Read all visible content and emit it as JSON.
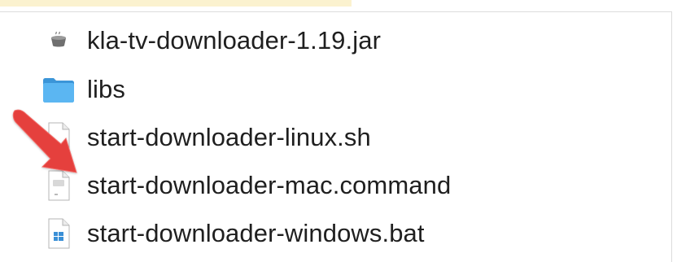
{
  "files": [
    {
      "name": "kla-tv-downloader-1.19.jar",
      "icon": "jar-icon",
      "type": "jar"
    },
    {
      "name": "libs",
      "icon": "folder-icon",
      "type": "folder"
    },
    {
      "name": "start-downloader-linux.sh",
      "icon": "document-icon",
      "type": "shell"
    },
    {
      "name": "start-downloader-mac.command",
      "icon": "terminal-document-icon",
      "type": "command"
    },
    {
      "name": "start-downloader-windows.bat",
      "icon": "windows-document-icon",
      "type": "bat"
    }
  ],
  "annotation": {
    "icon": "red-arrow-icon",
    "color": "#e5413d",
    "target": "start-downloader-mac.command"
  },
  "colors": {
    "highlight": "#fbf2cf",
    "folder": "#4aa8e8",
    "text": "#1f1f1f"
  }
}
